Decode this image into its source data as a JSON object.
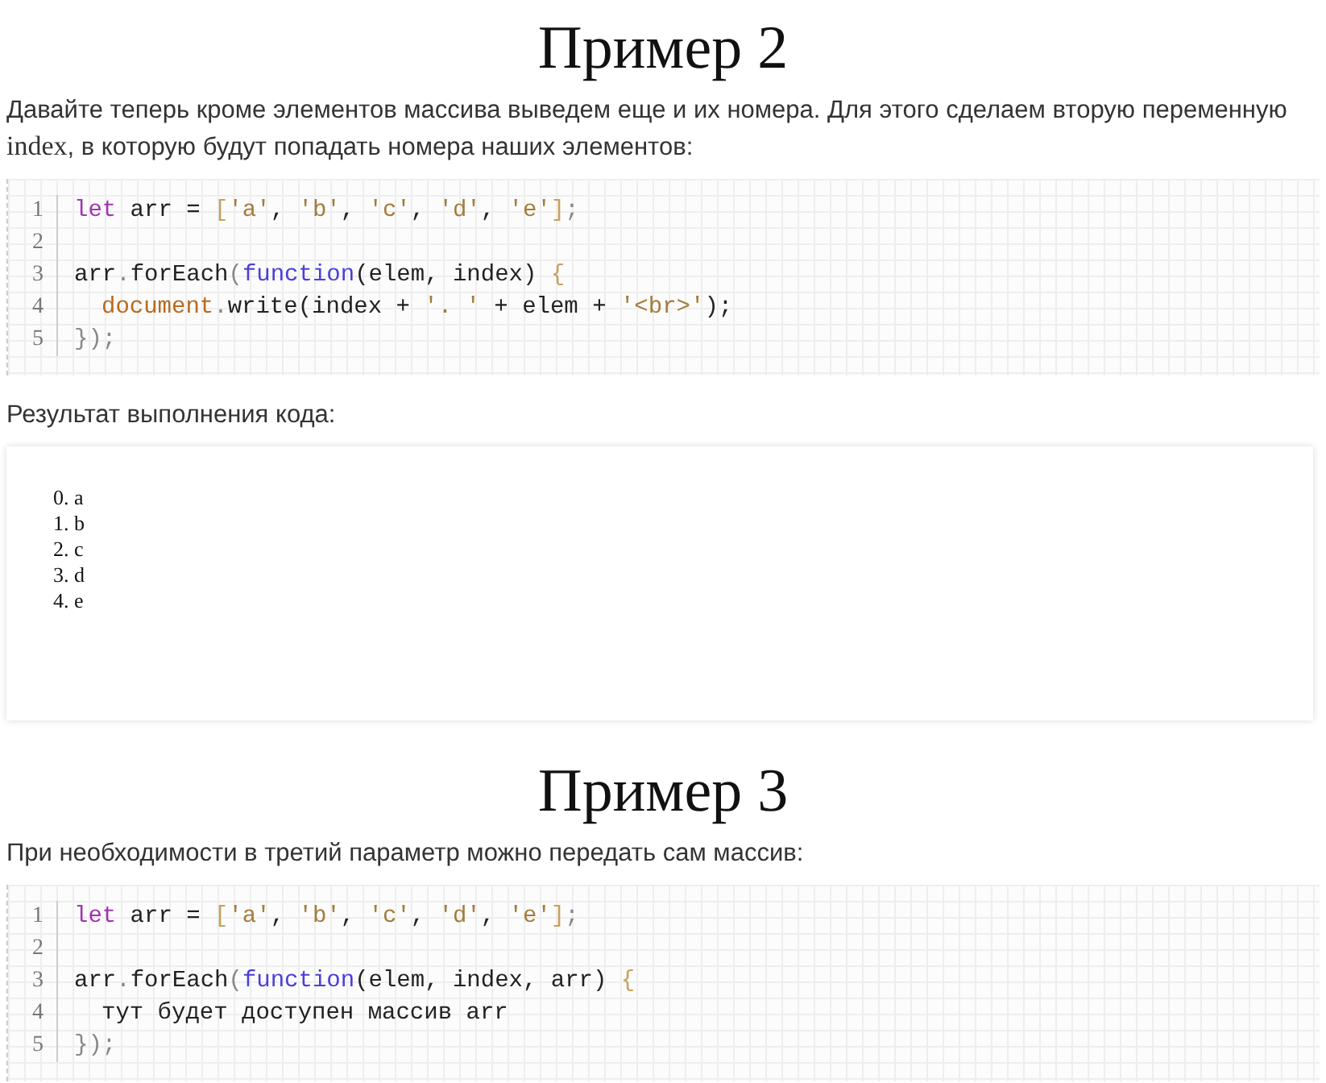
{
  "sections": [
    {
      "title": "Пример 2",
      "intro": [
        {
          "text": "Давайте теперь кроме элементов массива выведем еще и их номера. Для этого сделаем вторую переменную ",
          "kind": "text"
        },
        {
          "text": "index",
          "kind": "code"
        },
        {
          "text": ", в которую будут попадать номера наших элементов:",
          "kind": "text"
        }
      ],
      "code": [
        {
          "number": "1",
          "tokens": [
            {
              "text": "let",
              "kind": "keyword"
            },
            {
              "text": " arr = ",
              "kind": "plain"
            },
            {
              "text": "[",
              "kind": "bracket"
            },
            {
              "text": "'a'",
              "kind": "string"
            },
            {
              "text": ", ",
              "kind": "plain"
            },
            {
              "text": "'b'",
              "kind": "string"
            },
            {
              "text": ", ",
              "kind": "plain"
            },
            {
              "text": "'c'",
              "kind": "string"
            },
            {
              "text": ", ",
              "kind": "plain"
            },
            {
              "text": "'d'",
              "kind": "string"
            },
            {
              "text": ", ",
              "kind": "plain"
            },
            {
              "text": "'e'",
              "kind": "string"
            },
            {
              "text": "]",
              "kind": "bracket"
            },
            {
              "text": ";",
              "kind": "punct"
            }
          ]
        },
        {
          "number": "2"
        },
        {
          "number": "3",
          "tokens": [
            {
              "text": "arr",
              "kind": "plain"
            },
            {
              "text": ".",
              "kind": "punct"
            },
            {
              "text": "forEach",
              "kind": "plain"
            },
            {
              "text": "(",
              "kind": "punct"
            },
            {
              "text": "function",
              "kind": "function"
            },
            {
              "text": "(elem, index) ",
              "kind": "plain"
            },
            {
              "text": "{",
              "kind": "bracket"
            }
          ]
        },
        {
          "number": "4",
          "indented": true,
          "tokens": [
            {
              "text": "document",
              "kind": "builtin"
            },
            {
              "text": ".",
              "kind": "punct"
            },
            {
              "text": "write(index + ",
              "kind": "plain"
            },
            {
              "text": "'. '",
              "kind": "string"
            },
            {
              "text": " + elem + ",
              "kind": "plain"
            },
            {
              "text": "'<br>'",
              "kind": "string"
            },
            {
              "text": ");",
              "kind": "plain"
            }
          ]
        },
        {
          "number": "5",
          "tokens": [
            {
              "text": "});",
              "kind": "punct"
            }
          ]
        }
      ],
      "result_label": "Результат выполнения кода:",
      "output": [
        "0. a",
        "1. b",
        "2. c",
        "3. d",
        "4. e"
      ]
    },
    {
      "title": "Пример 3",
      "intro": [
        {
          "text": "При необходимости в третий параметр можно передать сам массив:",
          "kind": "text"
        }
      ],
      "code": [
        {
          "number": "1",
          "tokens": [
            {
              "text": "let",
              "kind": "keyword"
            },
            {
              "text": " arr = ",
              "kind": "plain"
            },
            {
              "text": "[",
              "kind": "bracket"
            },
            {
              "text": "'a'",
              "kind": "string"
            },
            {
              "text": ", ",
              "kind": "plain"
            },
            {
              "text": "'b'",
              "kind": "string"
            },
            {
              "text": ", ",
              "kind": "plain"
            },
            {
              "text": "'c'",
              "kind": "string"
            },
            {
              "text": ", ",
              "kind": "plain"
            },
            {
              "text": "'d'",
              "kind": "string"
            },
            {
              "text": ", ",
              "kind": "plain"
            },
            {
              "text": "'e'",
              "kind": "string"
            },
            {
              "text": "]",
              "kind": "bracket"
            },
            {
              "text": ";",
              "kind": "punct"
            }
          ]
        },
        {
          "number": "2"
        },
        {
          "number": "3",
          "tokens": [
            {
              "text": "arr",
              "kind": "plain"
            },
            {
              "text": ".",
              "kind": "punct"
            },
            {
              "text": "forEach",
              "kind": "plain"
            },
            {
              "text": "(",
              "kind": "punct"
            },
            {
              "text": "function",
              "kind": "function"
            },
            {
              "text": "(elem, index, arr) ",
              "kind": "plain"
            },
            {
              "text": "{",
              "kind": "bracket"
            }
          ]
        },
        {
          "number": "4",
          "indented": true,
          "tokens": [
            {
              "text": "тут будет доступен массив arr",
              "kind": "plain"
            }
          ]
        },
        {
          "number": "5",
          "tokens": [
            {
              "text": "});",
              "kind": "punct"
            }
          ]
        }
      ]
    }
  ]
}
